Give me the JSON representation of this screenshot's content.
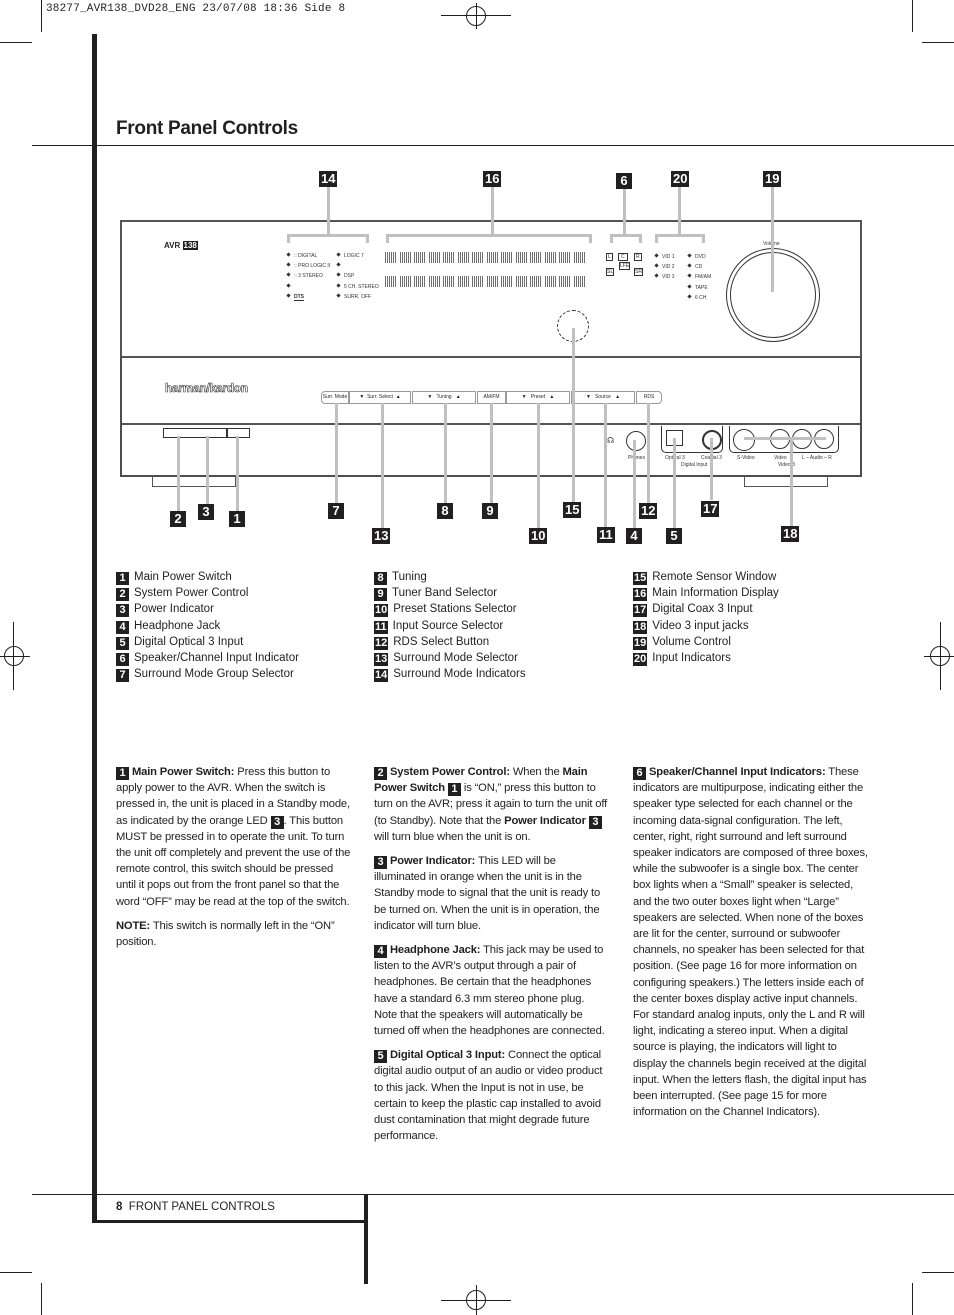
{
  "slug": "38277_AVR138_DVD28_ENG  23/07/08  18:36  Side 8",
  "page_title": "Front Panel Controls",
  "diagram": {
    "model_label": "AVR",
    "model_number": "138",
    "brand": "harman/kardon",
    "surround_indicators_left": [
      "DIGITAL",
      "PRO LOGIC II",
      "3 STEREO",
      "",
      "DTS"
    ],
    "surround_indicators_right": [
      "LOGIC 7",
      "",
      "DSP",
      "5 CH. STEREO",
      "SURR. OFF"
    ],
    "input_indicators_left": [
      "VID 1",
      "VID 2",
      "VID 3"
    ],
    "input_indicators_right": [
      "DVD",
      "CD",
      "FM/AM",
      "TAPE",
      "6 CH"
    ],
    "speaker_boxes": [
      "L",
      "C",
      "R",
      "LFE",
      "SL",
      "SR"
    ],
    "volume_label": "Volume",
    "buttons": [
      "Surr. Mode",
      "Surr. Select",
      "Tuning",
      "AM/FM",
      "Preset",
      "Source",
      "RDS"
    ],
    "jacks": {
      "phones": "Phones",
      "optical": "Optical 3",
      "coaxial": "Coaxial 3",
      "digital_input": "Digital Input",
      "svideo": "S-Video",
      "video": "Video",
      "audio": "L – Audio – R",
      "video3": "Video 3"
    },
    "callouts_top": [
      "14",
      "16",
      "6",
      "20",
      "19"
    ],
    "callouts_bottom": [
      "2",
      "3",
      "1",
      "7",
      "13",
      "8",
      "9",
      "10",
      "15",
      "11",
      "4",
      "12",
      "5",
      "17",
      "18"
    ]
  },
  "legend": {
    "col1": [
      {
        "num": "1",
        "label": "Main Power Switch"
      },
      {
        "num": "2",
        "label": "System Power Control"
      },
      {
        "num": "3",
        "label": "Power Indicator"
      },
      {
        "num": "4",
        "label": "Headphone Jack"
      },
      {
        "num": "5",
        "label": "Digital Optical 3 Input"
      },
      {
        "num": "6",
        "label": "Speaker/Channel Input Indicator"
      },
      {
        "num": "7",
        "label": "Surround Mode Group Selector"
      }
    ],
    "col2": [
      {
        "num": "8",
        "label": "Tuning"
      },
      {
        "num": "9",
        "label": "Tuner Band Selector"
      },
      {
        "num": "10",
        "label": "Preset Stations Selector"
      },
      {
        "num": "11",
        "label": "Input Source Selector"
      },
      {
        "num": "12",
        "label": "RDS Select Button"
      },
      {
        "num": "13",
        "label": "Surround Mode Selector"
      },
      {
        "num": "14",
        "label": "Surround Mode Indicators"
      }
    ],
    "col3": [
      {
        "num": "15",
        "label": "Remote Sensor Window"
      },
      {
        "num": "16",
        "label": "Main Information Display"
      },
      {
        "num": "17",
        "label": "Digital Coax 3 Input"
      },
      {
        "num": "18",
        "label": "Video 3 input jacks"
      },
      {
        "num": "19",
        "label": "Volume Control"
      },
      {
        "num": "20",
        "label": "Input Indicators"
      }
    ]
  },
  "body": {
    "p1": {
      "num": "1",
      "head": "Main Power Switch:",
      "text_a": " Press this button to apply power to the AVR. When the switch is pressed in, the unit is placed in a Standby mode, as indicated by the orange LED ",
      "ref": "3",
      "text_b": ". This button MUST be pressed in to operate the unit. To turn the unit off completely and prevent the use of the remote control, this switch should be pressed until it pops out from the front panel so that the word “OFF” may be read at the top of the switch."
    },
    "note": {
      "head": "NOTE:",
      "text": " This switch is normally left in the “ON” position."
    },
    "p2": {
      "num": "2",
      "head": "System Power Control:",
      "text_a": " When the ",
      "bold_a": "Main Power Switch",
      "ref_a": "1",
      "text_b": " is “ON,” press this button to turn on the AVR; press it again to turn the unit off (to Standby). Note that the ",
      "bold_b": "Power Indicator",
      "ref_b": "3",
      "text_c": " will turn blue when the unit is on."
    },
    "p3": {
      "num": "3",
      "head": "Power Indicator:",
      "text": " This LED will be illuminated in orange when the unit is in the Standby mode to signal that the unit is ready to be turned on. When the unit is in operation, the indicator will turn blue."
    },
    "p4": {
      "num": "4",
      "head": "Headphone Jack:",
      "text": " This jack may be used to listen to the AVR’s output through a pair of headphones. Be certain that the headphones have a standard 6.3 mm stereo phone plug. Note that the speakers will automatically be turned off when the headphones are connected."
    },
    "p5": {
      "num": "5",
      "head": "Digital Optical 3 Input:",
      "text": " Connect the optical digital audio output of an audio or video product to this jack. When the Input is not in use, be certain to keep the plastic cap installed to avoid dust contamination that might degrade future performance."
    },
    "p6": {
      "num": "6",
      "head": "Speaker/Channel Input Indicators:",
      "text": " These indicators are multipurpose, indicating either the speaker type selected for each channel or the incoming data-signal configuration. The left, center, right, right surround and left surround speaker indicators are composed of three boxes, while the subwoofer is a single box. The center box lights when a “Small” speaker is selected, and the two outer boxes light when “Large” speakers are selected. When none of the boxes are lit for the center, surround or subwoofer channels, no speaker has been selected for that position. (See page 16 for more information on configuring speakers.) The letters inside each of the center boxes display active input channels. For standard analog inputs, only the L and R will light, indicating a stereo input. When a digital source is playing, the indicators will light to display the channels begin received at the digital input. When the letters flash, the digital input has been interrupted. (See page 15 for more information on the Channel Indicators)."
    }
  },
  "footer": {
    "page": "8",
    "section": "FRONT PANEL CONTROLS"
  }
}
